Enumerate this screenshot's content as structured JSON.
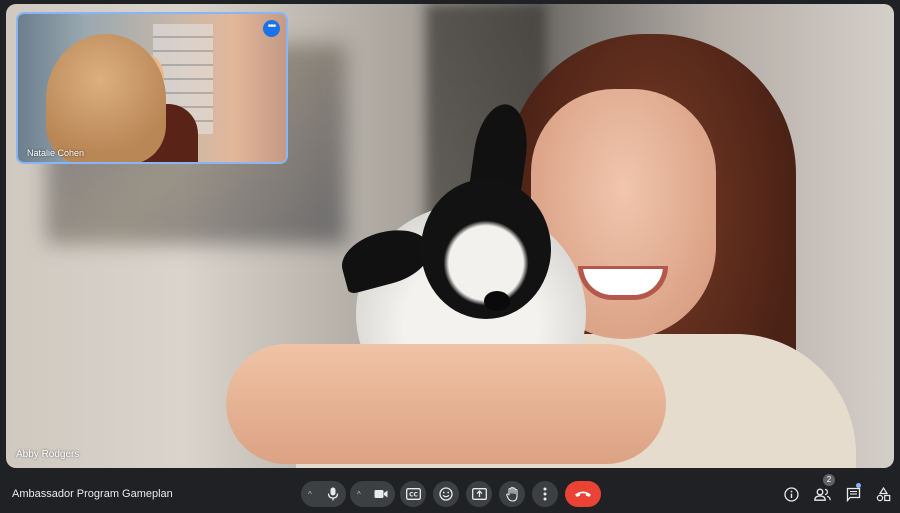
{
  "main_participant": {
    "name": "Abby Rodgers"
  },
  "self_view": {
    "name": "Natalie Cohen",
    "more_options_icon": "more-horiz-icon"
  },
  "meeting": {
    "title": "Ambassador Program Gameplan"
  },
  "controls": [
    {
      "name": "microphone",
      "icon": "mic-icon",
      "has_options": true
    },
    {
      "name": "camera",
      "icon": "videocam-icon",
      "has_options": true
    },
    {
      "name": "captions",
      "icon": "closed-caption-icon",
      "label": "CC"
    },
    {
      "name": "reactions",
      "icon": "emoji-icon"
    },
    {
      "name": "present",
      "icon": "present-screen-icon"
    },
    {
      "name": "raise-hand",
      "icon": "hand-icon"
    },
    {
      "name": "more-options",
      "icon": "more-vert-icon"
    },
    {
      "name": "leave-call",
      "icon": "call-end-icon"
    }
  ],
  "side_panel": {
    "people_count": "2",
    "icons": [
      "info-icon",
      "people-icon",
      "chat-icon",
      "activities-icon"
    ]
  },
  "colors": {
    "background": "#202124",
    "control": "#3c4043",
    "hangup": "#ea4335",
    "accent": "#8ab4f8",
    "active_badge": "#1a73e8"
  }
}
